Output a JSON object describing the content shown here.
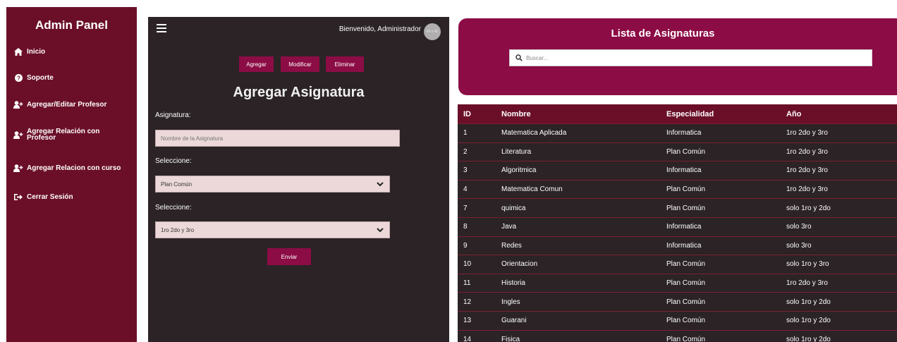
{
  "sidebar": {
    "title": "Admin Panel",
    "items": [
      {
        "icon": "home-icon",
        "label": "Inicio"
      },
      {
        "icon": "help-circle-icon",
        "label": "Soporte"
      },
      {
        "icon": "user-plus-icon",
        "label": "Agregar/Editar Profesor"
      },
      {
        "icon": "user-plus-icon",
        "label": "Agregar Relación con Profesor"
      },
      {
        "icon": "user-plus-icon",
        "label": "Agregar Relacion con curso"
      },
      {
        "icon": "sign-out-icon",
        "label": "Cerrar Sesión"
      }
    ]
  },
  "topbar": {
    "menu_icon": "hamburger-menu-icon",
    "welcome": "Bienvenido, Administrador",
    "avatar_text": "40 x 40"
  },
  "actions": {
    "add": "Agregar",
    "modify": "Modificar",
    "delete": "Eliminar"
  },
  "form": {
    "title": "Agregar Asignatura",
    "subject_label": "Asignatura:",
    "subject_placeholder": "Nombre de la Asignatura",
    "specialty_label": "Seleccione:",
    "specialty_value": "Plan Común",
    "year_label": "Seleccione:",
    "year_value": "1ro 2do y 3ro",
    "submit": "Enviar"
  },
  "list": {
    "title": "Lista de Asignaturas",
    "search_placeholder": "Buscar...",
    "search_icon": "search-icon",
    "columns": [
      "ID",
      "Nombre",
      "Especialidad",
      "Año"
    ],
    "rows": [
      [
        "1",
        "Matematica Aplicada",
        "Informatica",
        "1ro 2do y 3ro"
      ],
      [
        "2",
        "Literatura",
        "Plan Común",
        "1ro 2do y 3ro"
      ],
      [
        "3",
        "Algoritmica",
        "Informatica",
        "1ro 2do y 3ro"
      ],
      [
        "4",
        "Matematica Comun",
        "Plan Común",
        "1ro 2do y 3ro"
      ],
      [
        "7",
        "quimica",
        "Plan Común",
        "solo 1ro y 2do"
      ],
      [
        "8",
        "Java",
        "Informatica",
        "solo 3ro"
      ],
      [
        "9",
        "Redes",
        "Informatica",
        "solo 3ro"
      ],
      [
        "10",
        "Orientacion",
        "Plan Común",
        "solo 1ro y 3ro"
      ],
      [
        "11",
        "Historia",
        "Plan Común",
        "1ro 2do y 3ro"
      ],
      [
        "12",
        "Ingles",
        "Plan Común",
        "solo 1ro y 2do"
      ],
      [
        "13",
        "Guarani",
        "Plan Común",
        "solo 1ro y 2do"
      ],
      [
        "14",
        "Fisica",
        "Plan Común",
        "solo 1ro y 2do"
      ]
    ]
  },
  "colors": {
    "sidebar": "#6b0f28",
    "accent": "#8c0c45",
    "panel": "#2b2326",
    "input": "#ecd8d8"
  }
}
